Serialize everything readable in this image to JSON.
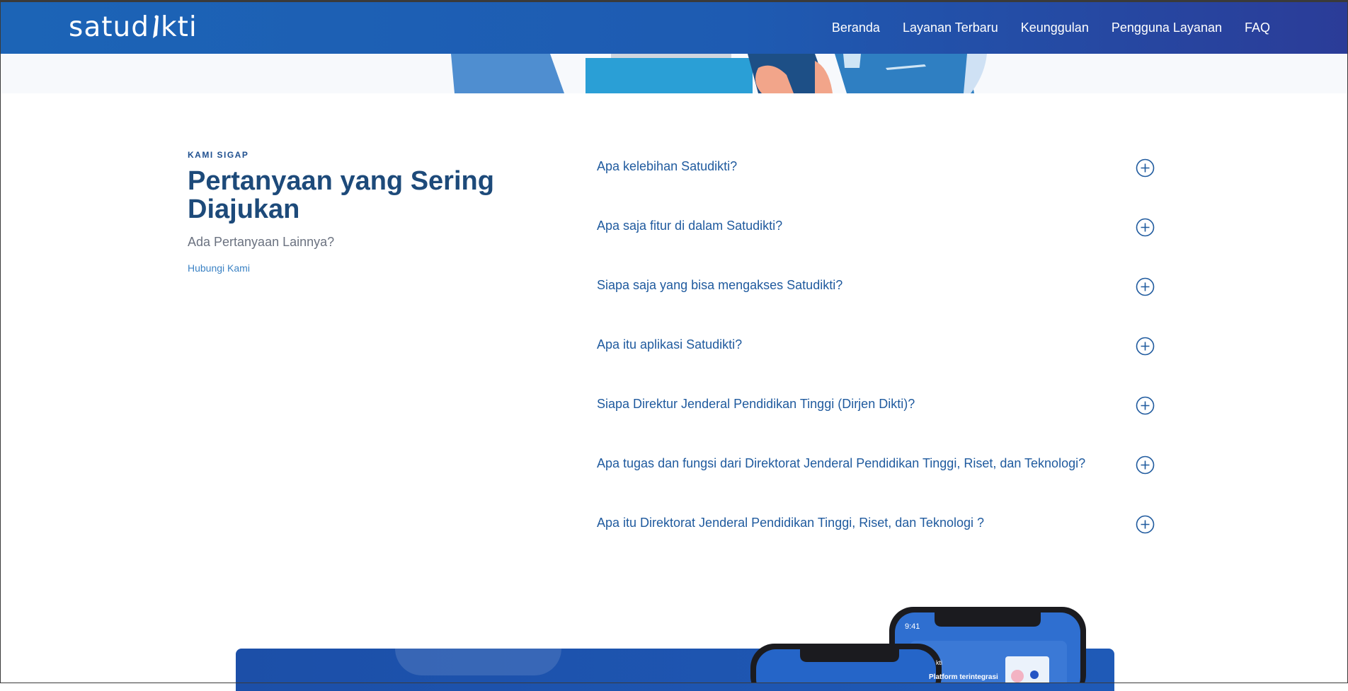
{
  "brand": {
    "logo_text_left": "satud",
    "logo_text_right": "kti"
  },
  "nav": {
    "items": [
      {
        "label": "Beranda"
      },
      {
        "label": "Layanan Terbaru"
      },
      {
        "label": "Keunggulan"
      },
      {
        "label": "Pengguna Layanan"
      },
      {
        "label": "FAQ"
      }
    ]
  },
  "faq": {
    "eyebrow": "KAMI SIGAP",
    "title": "Pertanyaan yang Sering Diajukan",
    "subtitle": "Ada Pertanyaan Lainnya?",
    "contact_link": "Hubungi Kami",
    "questions": [
      {
        "q": "Apa kelebihan Satudikti?"
      },
      {
        "q": "Apa saja fitur di dalam Satudikti?"
      },
      {
        "q": "Siapa saja yang bisa mengakses Satudikti?"
      },
      {
        "q": "Apa itu aplikasi Satudikti?"
      },
      {
        "q": "Siapa Direktur Jenderal Pendidikan Tinggi (Dirjen Dikti)?"
      },
      {
        "q": "Apa tugas dan fungsi dari Direktorat Jenderal Pendidikan Tinggi, Riset, dan Teknologi?"
      },
      {
        "q": "Apa itu Direktorat Jenderal Pendidikan Tinggi, Riset, dan Teknologi ?"
      }
    ]
  },
  "phones": {
    "status_time": "9:41",
    "screen_text_1": "Platform terintegrasi",
    "screen_text_2": "kti"
  },
  "colors": {
    "nav_start": "#1c64b6",
    "nav_end": "#2b3c98",
    "accent_text": "#1f5a9e",
    "title": "#1d4a7a"
  },
  "icons": {
    "accordion_toggle": "plus-circle-icon"
  }
}
